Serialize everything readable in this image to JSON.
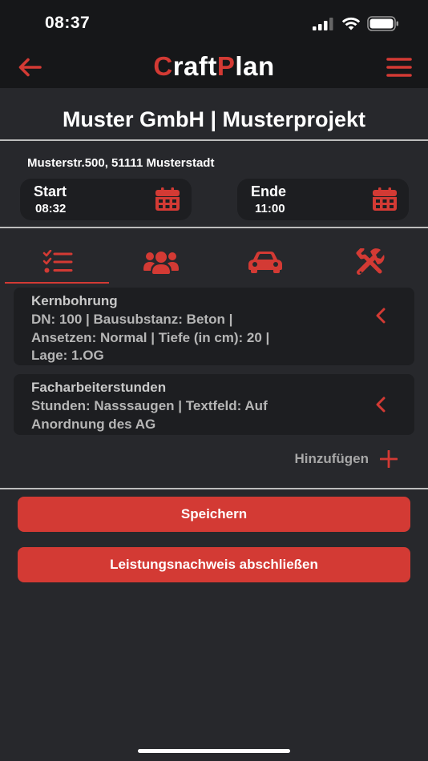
{
  "status_bar": {
    "time": "08:37",
    "icons": [
      "signal-icon",
      "wifi-icon",
      "battery-icon"
    ]
  },
  "header": {
    "logo_parts": [
      {
        "text": "C",
        "accent": true
      },
      {
        "text": "raft",
        "accent": false
      },
      {
        "text": "P",
        "accent": true
      },
      {
        "text": "lan",
        "accent": false
      }
    ],
    "back_icon": "arrow-left-icon",
    "menu_icon": "hamburger-menu-icon"
  },
  "project": {
    "title": "Muster GmbH | Musterprojekt",
    "address": "Musterstr.500, 51111 Musterstadt"
  },
  "times": {
    "start": {
      "label": "Start",
      "value": "08:32",
      "icon": "calendar-icon"
    },
    "end": {
      "label": "Ende",
      "value": "11:00",
      "icon": "calendar-icon"
    }
  },
  "tabs": [
    {
      "icon": "checklist-icon",
      "active": true
    },
    {
      "icon": "users-icon",
      "active": false
    },
    {
      "icon": "car-icon",
      "active": false
    },
    {
      "icon": "tools-icon",
      "active": false
    }
  ],
  "items": [
    {
      "title": "Kernbohrung",
      "lines": [
        "DN: 100 | Bausubstanz: Beton |",
        "Ansetzen: Normal | Tiefe (in cm): 20 |",
        "Lage: 1.OG"
      ]
    },
    {
      "title": "Facharbeiterstunden",
      "lines": [
        "Stunden: Nasssaugen | Textfeld: Auf",
        "Anordnung des AG"
      ]
    }
  ],
  "add": {
    "label": "Hinzufügen",
    "icon": "plus-icon"
  },
  "buttons": {
    "save": "Speichern",
    "complete": "Leistungsnachweis abschließen"
  },
  "colors": {
    "accent": "#d33a34",
    "background": "#27282c",
    "header_background": "#161719",
    "card_background": "#1d1e21"
  }
}
